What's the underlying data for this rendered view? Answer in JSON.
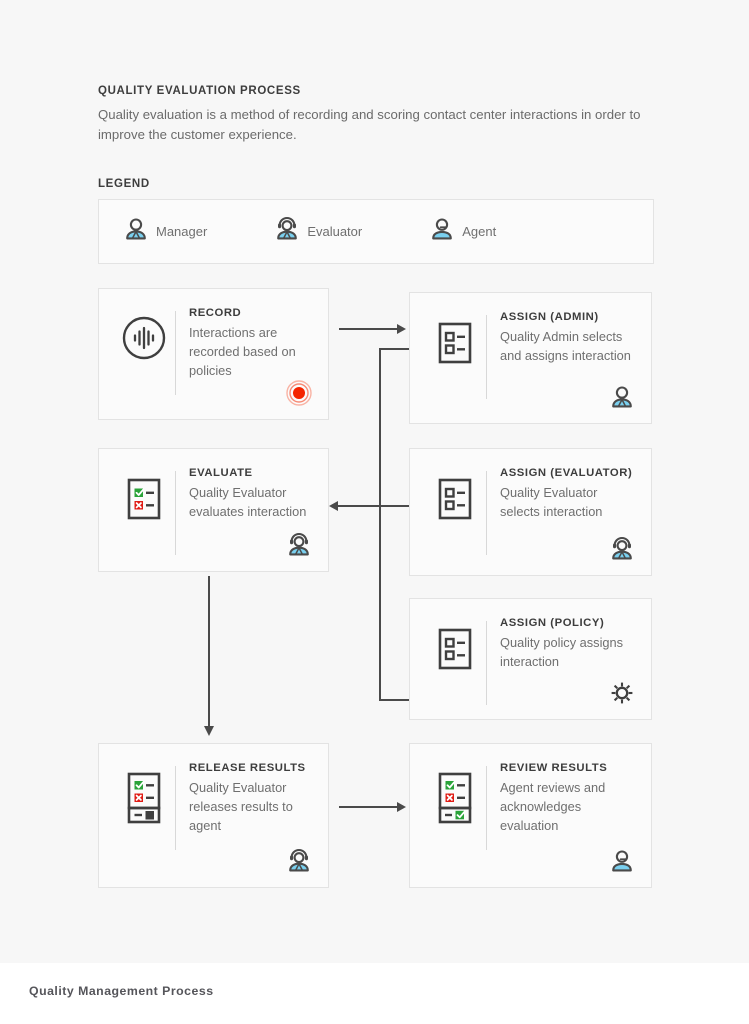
{
  "header": {
    "title": "QUALITY EVALUATION PROCESS",
    "description": "Quality evaluation is a method of recording and scoring contact center interactions in order to improve the customer experience."
  },
  "legend": {
    "title": "LEGEND",
    "items": [
      {
        "label": "Manager",
        "icon": "person-manager-icon"
      },
      {
        "label": "Evaluator",
        "icon": "person-evaluator-icon"
      },
      {
        "label": "Agent",
        "icon": "person-agent-icon"
      }
    ]
  },
  "flow": {
    "cards": [
      {
        "id": "record",
        "title": "RECORD",
        "description": "Interactions are recorded based on policies",
        "icon": "audio-waveform-circle-icon",
        "badge": "record-dot-icon"
      },
      {
        "id": "assign-admin",
        "title": "ASSIGN (ADMIN)",
        "description": "Quality Admin selects and assigns interaction",
        "icon": "checklist-icon",
        "badge": "person-manager-icon"
      },
      {
        "id": "evaluate",
        "title": "EVALUATE",
        "description": "Quality Evaluator evaluates interaction",
        "icon": "checklist-scored-icon",
        "badge": "person-evaluator-icon"
      },
      {
        "id": "assign-evaluator",
        "title": "ASSIGN (EVALUATOR)",
        "description": "Quality Evaluator selects interaction",
        "icon": "checklist-icon",
        "badge": "person-evaluator-icon"
      },
      {
        "id": "assign-policy",
        "title": "ASSIGN (POLICY)",
        "description": "Quality policy assigns interaction",
        "icon": "checklist-icon",
        "badge": "gear-icon"
      },
      {
        "id": "release-results",
        "title": "RELEASE RESULTS",
        "description": "Quality Evaluator releases results to agent",
        "icon": "checklist-release-icon",
        "badge": "person-evaluator-icon"
      },
      {
        "id": "review-results",
        "title": "REVIEW RESULTS",
        "description": "Agent reviews and acknowledges evaluation",
        "icon": "checklist-review-icon",
        "badge": "person-agent-icon"
      }
    ]
  },
  "footer": {
    "text": "Quality Management Process"
  },
  "colors": {
    "page_background": "#f7f7f7",
    "card_background": "#fbfbfb",
    "card_border": "#e3e3e3",
    "heading": "#3d3d3d",
    "body_text": "#6f6f6f",
    "connector": "#4a4a4a",
    "person_accent": "#7ad0ef",
    "record_red": "#f42500",
    "check_green": "#2aa339",
    "cross_red": "#e01b14"
  }
}
